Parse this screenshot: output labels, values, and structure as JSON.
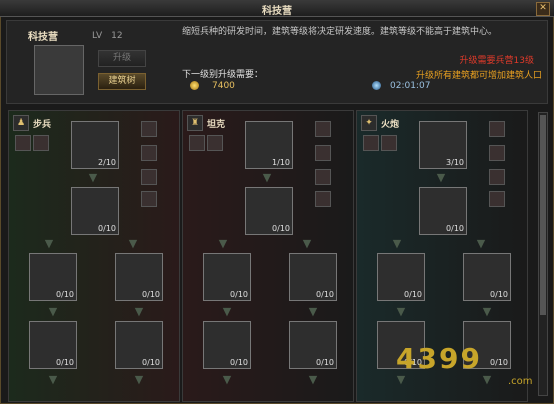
{
  "window": {
    "title": "科技营",
    "close": "✕"
  },
  "building": {
    "name": "科技营",
    "level": "LV　12",
    "upgrade_label": "升级",
    "build_tree_label": "建筑树"
  },
  "description": "缩短兵种的研发时间，建筑等级将决定研发速度。建筑等级不能高于建筑中心。",
  "requirements": {
    "heading": "下一级别升级需要：",
    "troop_req": "升级需要兵营13级",
    "upgrade_hint": "升级所有建筑都可增加建筑人口",
    "gold": "7400",
    "time": "02:01:07"
  },
  "columns": [
    {
      "name": "步兵",
      "units": [
        {
          "count": "2/10"
        },
        {
          "count": "0/10"
        },
        {
          "count": "0/10"
        },
        {
          "count": "0/10"
        },
        {
          "count": "0/10"
        },
        {
          "count": "0/10"
        }
      ]
    },
    {
      "name": "坦克",
      "units": [
        {
          "count": "1/10"
        },
        {
          "count": "0/10"
        },
        {
          "count": "0/10"
        },
        {
          "count": "0/10"
        },
        {
          "count": "0/10"
        },
        {
          "count": "0/10"
        }
      ]
    },
    {
      "name": "火炮",
      "units": [
        {
          "count": "3/10"
        },
        {
          "count": "0/10"
        },
        {
          "count": "0/10"
        },
        {
          "count": "0/10"
        },
        {
          "count": "0/10"
        },
        {
          "count": "0/10"
        }
      ]
    }
  ],
  "watermark": {
    "text": "4399",
    "domain": ".com"
  }
}
